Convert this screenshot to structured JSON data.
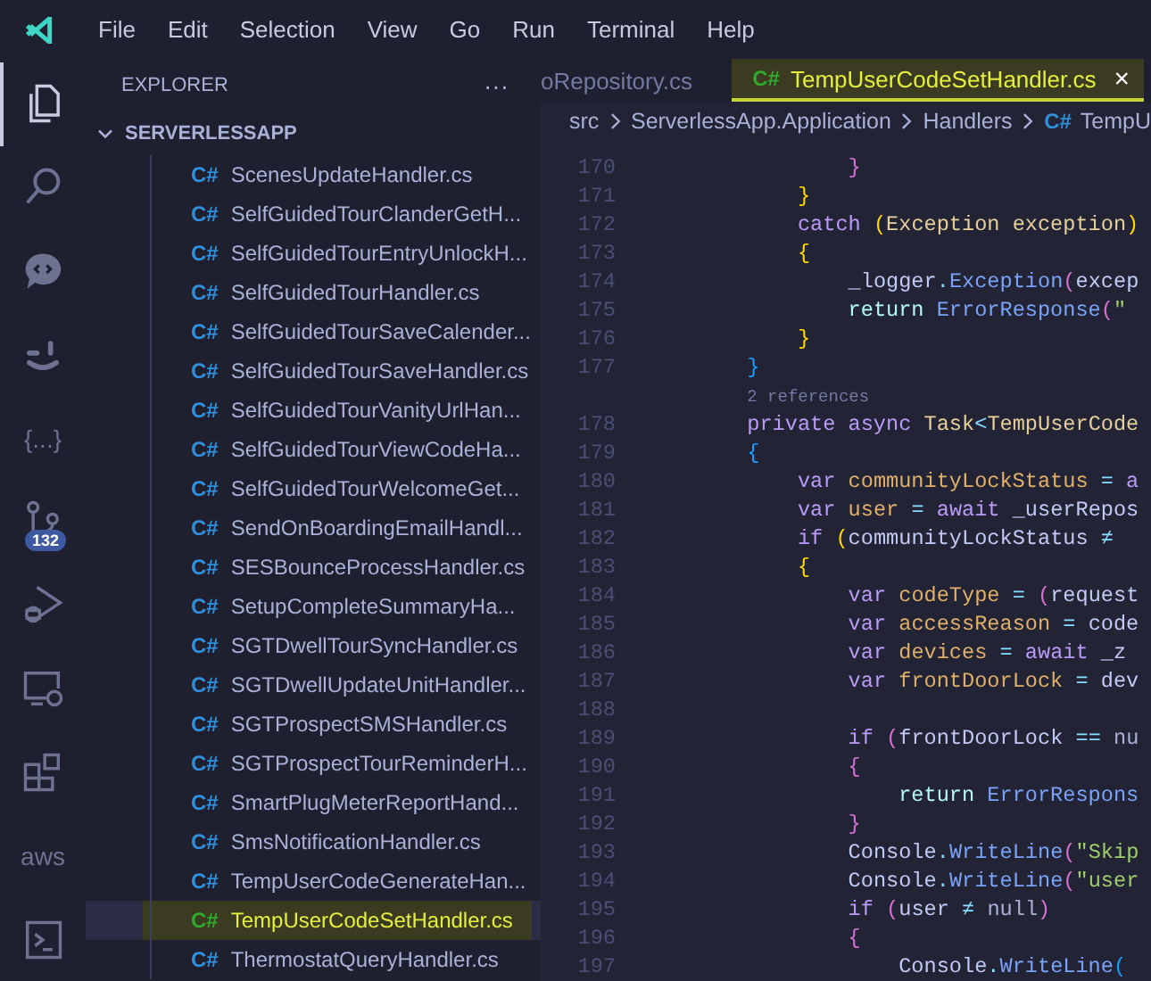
{
  "menu_bar": {
    "items": [
      "File",
      "Edit",
      "Selection",
      "View",
      "Go",
      "Run",
      "Terminal",
      "Help"
    ]
  },
  "activity_bar": [
    {
      "kind": "files",
      "selected": true
    },
    {
      "kind": "search",
      "selected": false
    },
    {
      "kind": "chat",
      "selected": false
    },
    {
      "kind": "smile",
      "selected": false
    },
    {
      "kind": "text",
      "label": "{...}",
      "selected": false
    },
    {
      "kind": "source",
      "badge": "132",
      "selected": false
    },
    {
      "kind": "debug",
      "selected": false
    },
    {
      "kind": "remote",
      "selected": false
    },
    {
      "kind": "extensions",
      "selected": false
    },
    {
      "kind": "text",
      "label": "aws",
      "selected": false
    },
    {
      "kind": "terminal",
      "selected": false
    }
  ],
  "sidebar": {
    "title": "EXPLORER",
    "more": "···",
    "folder": {
      "name": "SERVERLESSAPP",
      "expanded": true,
      "children": [
        {
          "lang": "C#",
          "name": "ScenesUpdateHandler.cs",
          "selected": false
        },
        {
          "lang": "C#",
          "name": "SelfGuidedTourClanderGetH...",
          "selected": false
        },
        {
          "lang": "C#",
          "name": "SelfGuidedTourEntryUnlockH...",
          "selected": false
        },
        {
          "lang": "C#",
          "name": "SelfGuidedTourHandler.cs",
          "selected": false
        },
        {
          "lang": "C#",
          "name": "SelfGuidedTourSaveCalender...",
          "selected": false
        },
        {
          "lang": "C#",
          "name": "SelfGuidedTourSaveHandler.cs",
          "selected": false
        },
        {
          "lang": "C#",
          "name": "SelfGuidedTourVanityUrlHan...",
          "selected": false
        },
        {
          "lang": "C#",
          "name": "SelfGuidedTourViewCodeHa...",
          "selected": false
        },
        {
          "lang": "C#",
          "name": "SelfGuidedTourWelcomeGet...",
          "selected": false
        },
        {
          "lang": "C#",
          "name": "SendOnBoardingEmailHandl...",
          "selected": false
        },
        {
          "lang": "C#",
          "name": "SESBounceProcessHandler.cs",
          "selected": false
        },
        {
          "lang": "C#",
          "name": "SetupCompleteSummaryHa...",
          "selected": false
        },
        {
          "lang": "C#",
          "name": "SGTDwellTourSyncHandler.cs",
          "selected": false
        },
        {
          "lang": "C#",
          "name": "SGTDwellUpdateUnitHandler...",
          "selected": false
        },
        {
          "lang": "C#",
          "name": "SGTProspectSMSHandler.cs",
          "selected": false
        },
        {
          "lang": "C#",
          "name": "SGTProspectTourReminderH...",
          "selected": false
        },
        {
          "lang": "C#",
          "name": "SmartPlugMeterReportHand...",
          "selected": false
        },
        {
          "lang": "C#",
          "name": "SmsNotificationHandler.cs",
          "selected": false
        },
        {
          "lang": "C#",
          "name": "TempUserCodeGenerateHan...",
          "selected": false
        },
        {
          "lang": "C#",
          "name": "TempUserCodeSetHandler.cs",
          "selected": true
        },
        {
          "lang": "C#",
          "name": "ThermostatQueryHandler.cs",
          "selected": false
        }
      ]
    }
  },
  "tabs": [
    {
      "label": "oRepository.cs",
      "selected": false
    },
    {
      "lang": "C#",
      "label": "TempUserCodeSetHandler.cs",
      "selected": true,
      "close": "×"
    }
  ],
  "breadcrumb": [
    {
      "text": "src"
    },
    {
      "text": "ServerlessApp.Application"
    },
    {
      "text": "Handlers"
    },
    {
      "lang": "C#",
      "text": "TempU"
    }
  ],
  "editor": {
    "lines": [
      {
        "kind": "code",
        "number": "170",
        "tokens": [
          {
            "text": "                }",
            "kind": "b2"
          }
        ]
      },
      {
        "kind": "code",
        "number": "171",
        "tokens": [
          {
            "text": "            }",
            "kind": "b1"
          }
        ]
      },
      {
        "kind": "code",
        "number": "172",
        "tokens": [
          {
            "text": "            catch ",
            "kind": "kw"
          },
          {
            "text": "(",
            "kind": "b1"
          },
          {
            "text": "Exception exception",
            "kind": "type"
          },
          {
            "text": ")",
            "kind": "b1"
          }
        ]
      },
      {
        "kind": "code",
        "number": "173",
        "tokens": [
          {
            "text": "            {",
            "kind": "b1"
          }
        ]
      },
      {
        "kind": "code",
        "number": "174",
        "tokens": [
          {
            "text": "                _logger",
            "kind": "id"
          },
          {
            "text": ".",
            "kind": "op"
          },
          {
            "text": "Exception",
            "kind": "fn"
          },
          {
            "text": "(",
            "kind": "b2"
          },
          {
            "text": "excep",
            "kind": "id"
          }
        ]
      },
      {
        "kind": "code",
        "number": "175",
        "tokens": [
          {
            "text": "                return ",
            "kind": "ctl"
          },
          {
            "text": "ErrorResponse",
            "kind": "fn"
          },
          {
            "text": "(",
            "kind": "b2"
          },
          {
            "text": "\"",
            "kind": "str"
          }
        ]
      },
      {
        "kind": "code",
        "number": "176",
        "tokens": [
          {
            "text": "            }",
            "kind": "b1"
          }
        ]
      },
      {
        "kind": "code",
        "number": "177",
        "tokens": [
          {
            "text": "        }",
            "kind": "b3"
          }
        ]
      },
      {
        "kind": "codelens",
        "text": "        2 references"
      },
      {
        "kind": "code",
        "number": "178",
        "tokens": [
          {
            "text": "        private async ",
            "kind": "kw"
          },
          {
            "text": "Task",
            "kind": "type"
          },
          {
            "text": "<",
            "kind": "op"
          },
          {
            "text": "TempUserCode",
            "kind": "type"
          }
        ]
      },
      {
        "kind": "code",
        "number": "179",
        "tokens": [
          {
            "text": "        {",
            "kind": "b3"
          }
        ]
      },
      {
        "kind": "code",
        "number": "180",
        "tokens": [
          {
            "text": "            var ",
            "kind": "kw"
          },
          {
            "text": "communityLockStatus",
            "kind": "decl"
          },
          {
            "text": " = ",
            "kind": "op"
          },
          {
            "text": "a",
            "kind": "kw"
          }
        ]
      },
      {
        "kind": "code",
        "number": "181",
        "tokens": [
          {
            "text": "            var ",
            "kind": "kw"
          },
          {
            "text": "user",
            "kind": "decl"
          },
          {
            "text": " = ",
            "kind": "op"
          },
          {
            "text": "await ",
            "kind": "kw"
          },
          {
            "text": "_userRepos",
            "kind": "id"
          }
        ]
      },
      {
        "kind": "code",
        "number": "182",
        "tokens": [
          {
            "text": "            if ",
            "kind": "kw"
          },
          {
            "text": "(",
            "kind": "b1"
          },
          {
            "text": "communityLockStatus",
            "kind": "id"
          },
          {
            "text": " ≠",
            "kind": "op"
          }
        ]
      },
      {
        "kind": "code",
        "number": "183",
        "tokens": [
          {
            "text": "            {",
            "kind": "b1"
          }
        ]
      },
      {
        "kind": "code",
        "number": "184",
        "tokens": [
          {
            "text": "                var ",
            "kind": "kw"
          },
          {
            "text": "codeType",
            "kind": "decl"
          },
          {
            "text": " = ",
            "kind": "op"
          },
          {
            "text": "(",
            "kind": "b2"
          },
          {
            "text": "request",
            "kind": "id"
          }
        ]
      },
      {
        "kind": "code",
        "number": "185",
        "tokens": [
          {
            "text": "                var ",
            "kind": "kw"
          },
          {
            "text": "accessReason",
            "kind": "decl"
          },
          {
            "text": " = ",
            "kind": "op"
          },
          {
            "text": "code",
            "kind": "id"
          }
        ]
      },
      {
        "kind": "code",
        "number": "186",
        "tokens": [
          {
            "text": "                var ",
            "kind": "kw"
          },
          {
            "text": "devices",
            "kind": "decl"
          },
          {
            "text": " = ",
            "kind": "op"
          },
          {
            "text": "await ",
            "kind": "kw"
          },
          {
            "text": "_z",
            "kind": "id"
          }
        ]
      },
      {
        "kind": "code",
        "number": "187",
        "tokens": [
          {
            "text": "                var ",
            "kind": "kw"
          },
          {
            "text": "frontDoorLock",
            "kind": "decl"
          },
          {
            "text": " = ",
            "kind": "op"
          },
          {
            "text": "dev",
            "kind": "id"
          }
        ]
      },
      {
        "kind": "code",
        "number": "188"
      },
      {
        "kind": "code",
        "number": "189",
        "tokens": [
          {
            "text": "                if ",
            "kind": "kw"
          },
          {
            "text": "(",
            "kind": "b2"
          },
          {
            "text": "frontDoorLock",
            "kind": "id"
          },
          {
            "text": " == ",
            "kind": "op"
          },
          {
            "text": "nu",
            "kind": "lit"
          }
        ]
      },
      {
        "kind": "code",
        "number": "190",
        "tokens": [
          {
            "text": "                {",
            "kind": "b2"
          }
        ]
      },
      {
        "kind": "code",
        "number": "191",
        "tokens": [
          {
            "text": "                    return ",
            "kind": "ctl"
          },
          {
            "text": "ErrorRespons",
            "kind": "fn"
          }
        ]
      },
      {
        "kind": "code",
        "number": "192",
        "tokens": [
          {
            "text": "                }",
            "kind": "b2"
          }
        ]
      },
      {
        "kind": "code",
        "number": "193",
        "tokens": [
          {
            "text": "                Console",
            "kind": "id"
          },
          {
            "text": ".",
            "kind": "op"
          },
          {
            "text": "WriteLine",
            "kind": "fn"
          },
          {
            "text": "(",
            "kind": "b2"
          },
          {
            "text": "\"Skip",
            "kind": "str"
          }
        ]
      },
      {
        "kind": "code",
        "number": "194",
        "tokens": [
          {
            "text": "                Console",
            "kind": "id"
          },
          {
            "text": ".",
            "kind": "op"
          },
          {
            "text": "WriteLine",
            "kind": "fn"
          },
          {
            "text": "(",
            "kind": "b2"
          },
          {
            "text": "\"user",
            "kind": "str"
          }
        ]
      },
      {
        "kind": "code",
        "number": "195",
        "tokens": [
          {
            "text": "                if ",
            "kind": "kw"
          },
          {
            "text": "(",
            "kind": "b2"
          },
          {
            "text": "user",
            "kind": "id"
          },
          {
            "text": " ≠ ",
            "kind": "op"
          },
          {
            "text": "null",
            "kind": "lit"
          },
          {
            "text": ")",
            "kind": "b2"
          }
        ]
      },
      {
        "kind": "code",
        "number": "196",
        "tokens": [
          {
            "text": "                {",
            "kind": "b2"
          }
        ]
      },
      {
        "kind": "code",
        "number": "197",
        "tokens": [
          {
            "text": "                    Console",
            "kind": "id"
          },
          {
            "text": ".",
            "kind": "op"
          },
          {
            "text": "WriteLine",
            "kind": "fn"
          },
          {
            "text": "(",
            "kind": "b3"
          }
        ]
      }
    ]
  }
}
